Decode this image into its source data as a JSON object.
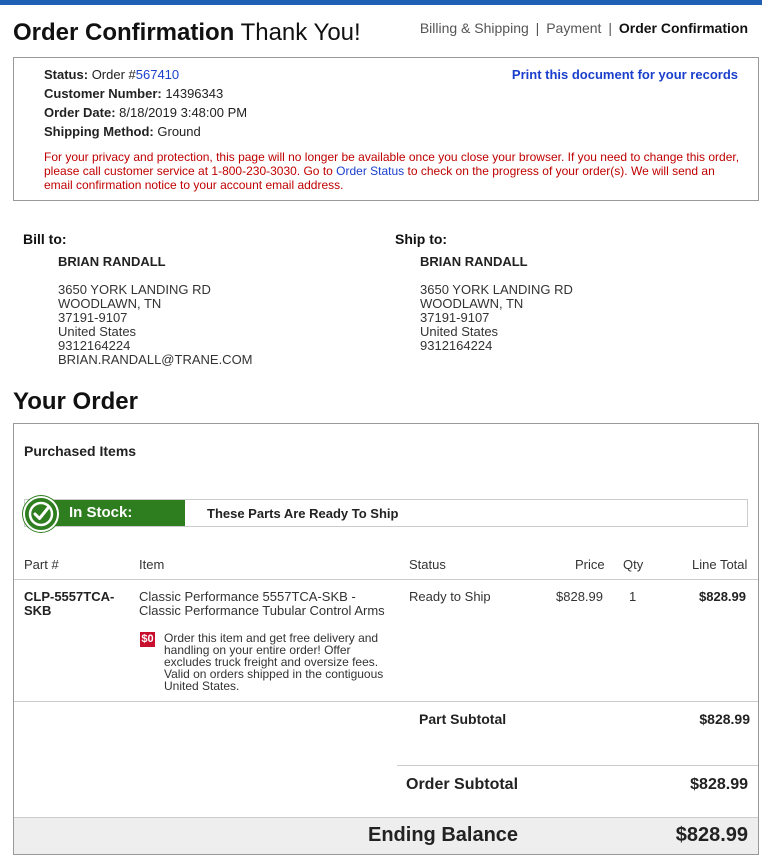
{
  "header": {
    "title_bold": "Order Confirmation",
    "title_rest": "Thank You!",
    "steps": [
      "Billing & Shipping",
      "Payment",
      "Order Confirmation"
    ],
    "steps_separator": "|"
  },
  "info": {
    "status_label": "Status:",
    "order_prefix": "Order #",
    "order_number": "567410",
    "customer_label": "Customer Number:",
    "customer_number": "14396343",
    "date_label": "Order Date:",
    "order_date": "8/18/2019 3:48:00 PM",
    "method_label": "Shipping Method:",
    "method": "Ground",
    "print_link": "Print this document for your records",
    "privacy_a": "For your privacy and protection, this page will no longer be available once you close your browser. If you need to change this order, please call customer service at 1-800-230-3030. Go to ",
    "privacy_link": "Order Status",
    "privacy_b": " to check on the progress of your order(s). We will send an email confirmation notice to your account email address."
  },
  "bill_to": {
    "heading": "Bill to:",
    "name": "BRIAN RANDALL",
    "street": "3650 YORK LANDING RD",
    "city": "WOODLAWN, TN",
    "zip": "37191-9107",
    "country": "United States",
    "phone": "9312164224",
    "email": "BRIAN.RANDALL@TRANE.COM"
  },
  "ship_to": {
    "heading": "Ship to:",
    "name": "BRIAN RANDALL",
    "street": "3650 YORK LANDING RD",
    "city": "WOODLAWN, TN",
    "zip": "37191-9107",
    "country": "United States",
    "phone": "9312164224"
  },
  "order": {
    "heading": "Your Order",
    "purchased_label": "Purchased Items",
    "stock_label": "In Stock:",
    "stock_message": "These Parts Are Ready To Ship",
    "columns": [
      "Part #",
      "Item",
      "Status",
      "Price",
      "Qty",
      "Line Total"
    ],
    "item": {
      "part_line1": "CLP-5557TCA-",
      "part_line2": "SKB",
      "desc_line1": "Classic Performance 5557TCA-SKB -",
      "desc_line2": "Classic Performance Tubular Control Arms",
      "status": "Ready to Ship",
      "price": "$828.99",
      "qty": "1",
      "line_total": "$828.99",
      "promo_icon": "$0",
      "promo_text": "Order this item and get free delivery and handling on your entire order! Offer excludes truck freight and oversize fees. Valid on orders shipped in the contiguous United States."
    },
    "part_subtotal_label": "Part Subtotal",
    "part_subtotal": "$828.99",
    "order_subtotal_label": "Order Subtotal",
    "order_subtotal": "$828.99",
    "ending_label": "Ending Balance",
    "ending_balance": "$828.99"
  },
  "colors": {
    "accent_blue": "#1f5fb4",
    "link_blue": "#1a3fcc",
    "warning_red": "#c00000",
    "stock_green": "#2e7d1e"
  }
}
